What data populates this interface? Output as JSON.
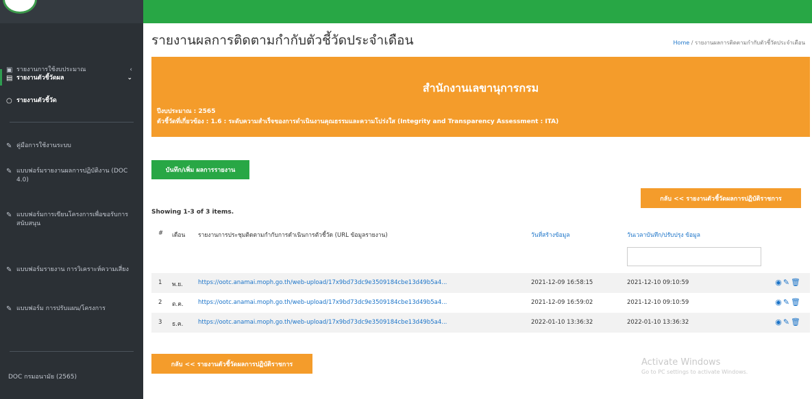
{
  "sidebar": {
    "items": [
      {
        "label": "รายงานการใช้งบประมาณ",
        "icon": "book-icon"
      },
      {
        "label": "รายงานตัวชี้วัดผล",
        "icon": "document-icon"
      },
      {
        "label": "รายงานตัวชี้วัด",
        "icon": "circle-icon"
      },
      {
        "label": "คู่มือการใช้งานระบบ",
        "icon": "pin-icon"
      },
      {
        "label": "แบบฟอร์มรายงานผลการปฏิบัติงาน (DOC 4.0)",
        "icon": "pin-icon"
      },
      {
        "label": "แบบฟอร์มการเขียนโครงการเพื่อขอรับการสนับสนุน",
        "icon": "pin-icon"
      },
      {
        "label": "แบบฟอร์มรายงาน การวิเคราะห์ความเสี่ยง",
        "icon": "pin-icon"
      },
      {
        "label": "แบบฟอร์ม การปรับแผน/โครงการ",
        "icon": "pin-icon"
      },
      {
        "label": "DOC กรมอนามัย (2565)",
        "icon": ""
      }
    ]
  },
  "header": {
    "title": "รายงานผลการติดตามกำกับตัวชี้วัดประจำเดือน",
    "breadcrumb_home": "Home",
    "breadcrumb_current": "รายงานผลการติดตามกำกับตัวชี้วัดประจำเดือน"
  },
  "banner": {
    "title": "สำนักงานเลขานุการกรม",
    "year": "ปีงบประมาณ : 2565",
    "kpi": "ตัวชี้วัดที่เกี่ยวข้อง : 1.6 : ระดับความสำเร็จของการดำเนินงานคุณธรรมและความโปร่งใส (Integrity and Transparency Assessment : ITA)"
  },
  "buttons": {
    "add": "บันทึก/เพิ่ม ผลการรายงาน",
    "back": "กลับ << รายงานตัวชี้วัดผลการปฏิบัติราชการ"
  },
  "table": {
    "summary": "Showing 1-3 of 3 items.",
    "columns": [
      "#",
      "เดือน",
      "รายงานการประชุมติดตามกำกับการดำเนินการตัวชี้วัด (URL ข้อมูลรายงาน)",
      "วันที่สร้างข้อมูล",
      "วันเวลาบันทึก/ปรับปรุง ข้อมูล"
    ],
    "rows": [
      {
        "num": "1",
        "month": "พ.ย.",
        "url": "https://ootc.anamai.moph.go.th/web-upload/17x9bd73dc9e3509184cbe13d49b5a4...",
        "created": "2021-12-09 16:58:15",
        "updated": "2021-12-10 09:10:59"
      },
      {
        "num": "2",
        "month": "ต.ค.",
        "url": "https://ootc.anamai.moph.go.th/web-upload/17x9bd73dc9e3509184cbe13d49b5a4...",
        "created": "2021-12-09 16:59:02",
        "updated": "2021-12-10 09:10:59"
      },
      {
        "num": "3",
        "month": "ธ.ค.",
        "url": "https://ootc.anamai.moph.go.th/web-upload/17x9bd73dc9e3509184cbe13d49b5a4...",
        "created": "2022-01-10 13:36:32",
        "updated": "2022-01-10 13:36:32"
      }
    ]
  },
  "watermark": {
    "line1": "Activate Windows",
    "line2": "Go to PC settings to activate Windows."
  },
  "colors": {
    "sidebar": "#2b3035",
    "topbar": "#28a745",
    "banner": "#f49c2b",
    "link": "#1a73c8"
  }
}
